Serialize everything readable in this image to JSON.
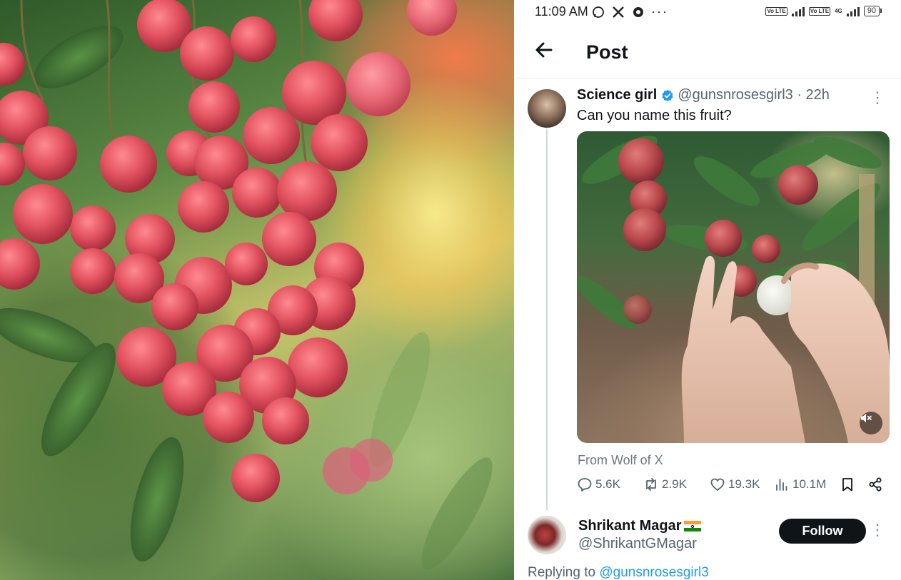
{
  "status_bar": {
    "time": "11:09 AM",
    "app_icons": [
      "whatsapp-icon",
      "x-icon",
      "record-icon"
    ],
    "more": "···",
    "network_badges": [
      "Vo LTE",
      "Vo LTE"
    ],
    "network_type": "4G",
    "battery": "90"
  },
  "header": {
    "title": "Post",
    "back_icon": "arrow-left-icon"
  },
  "tweet": {
    "author_name": "Science girl",
    "verified": true,
    "handle_time": "@gunsnrosesgirl3 · 22h",
    "text": "Can you name this fruit?",
    "source": "From Wolf of X",
    "mute_icon": "volume-mute-icon",
    "stats": {
      "replies": "5.6K",
      "reposts": "2.9K",
      "likes": "19.3K",
      "views": "10.1M"
    }
  },
  "reply": {
    "author_name": "Shrikant Magar",
    "handle": "@ShrikantGMagar",
    "follow_label": "Follow",
    "replying_prefix": "Replying to",
    "replying_handle": "@gunsnrosesgirl3"
  },
  "colors": {
    "accent": "#1d9bf0",
    "text_primary": "#0f1419",
    "text_secondary": "#536471",
    "follow_bg": "#0f1419"
  }
}
